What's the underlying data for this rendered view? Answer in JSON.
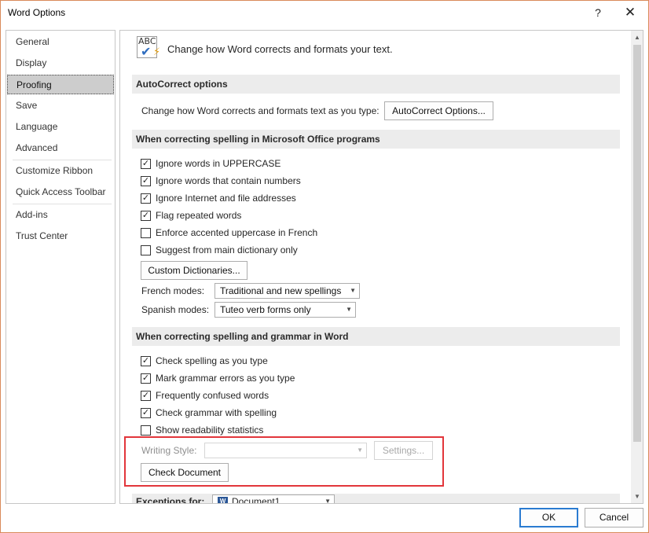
{
  "window": {
    "title": "Word Options",
    "help_glyph": "?",
    "close_glyph": "✕"
  },
  "sidebar": {
    "items": [
      {
        "label": "General"
      },
      {
        "label": "Display"
      },
      {
        "label": "Proofing",
        "selected": true
      },
      {
        "label": "Save"
      },
      {
        "label": "Language"
      },
      {
        "label": "Advanced"
      },
      {
        "label": "Customize Ribbon"
      },
      {
        "label": "Quick Access Toolbar"
      },
      {
        "label": "Add-ins"
      },
      {
        "label": "Trust Center"
      }
    ]
  },
  "header": {
    "icon": "abc-proofing-icon",
    "icon_text": "ABC",
    "text": "Change how Word corrects and formats your text."
  },
  "autocorrect": {
    "section_title": "AutoCorrect options",
    "description": "Change how Word corrects and formats text as you type:",
    "button_label": "AutoCorrect Options..."
  },
  "office_spelling": {
    "section_title": "When correcting spelling in Microsoft Office programs",
    "options": [
      {
        "label": "Ignore words in UPPERCASE",
        "checked": true
      },
      {
        "label": "Ignore words that contain numbers",
        "checked": true
      },
      {
        "label": "Ignore Internet and file addresses",
        "checked": true
      },
      {
        "label": "Flag repeated words",
        "checked": true
      },
      {
        "label": "Enforce accented uppercase in French",
        "checked": false
      },
      {
        "label": "Suggest from main dictionary only",
        "checked": false
      }
    ],
    "custom_dict_button": "Custom Dictionaries...",
    "french_modes_label": "French modes:",
    "french_modes_value": "Traditional and new spellings",
    "spanish_modes_label": "Spanish modes:",
    "spanish_modes_value": "Tuteo verb forms only"
  },
  "word_spelling": {
    "section_title": "When correcting spelling and grammar in Word",
    "options": [
      {
        "label": "Check spelling as you type",
        "checked": true
      },
      {
        "label": "Mark grammar errors as you type",
        "checked": true
      },
      {
        "label": "Frequently confused words",
        "checked": true
      },
      {
        "label": "Check grammar with spelling",
        "checked": true
      },
      {
        "label": "Show readability statistics",
        "checked": false
      }
    ],
    "writing_style_label": "Writing Style:",
    "writing_style_value": "",
    "settings_button": "Settings...",
    "check_document_button": "Check Document"
  },
  "exceptions": {
    "label": "Exceptions for:",
    "document": "Document1"
  },
  "footer": {
    "ok_label": "OK",
    "cancel_label": "Cancel"
  },
  "colors": {
    "highlight_border": "#e2363b",
    "ok_border": "#2a7bd1",
    "window_border": "#d98a5a"
  }
}
